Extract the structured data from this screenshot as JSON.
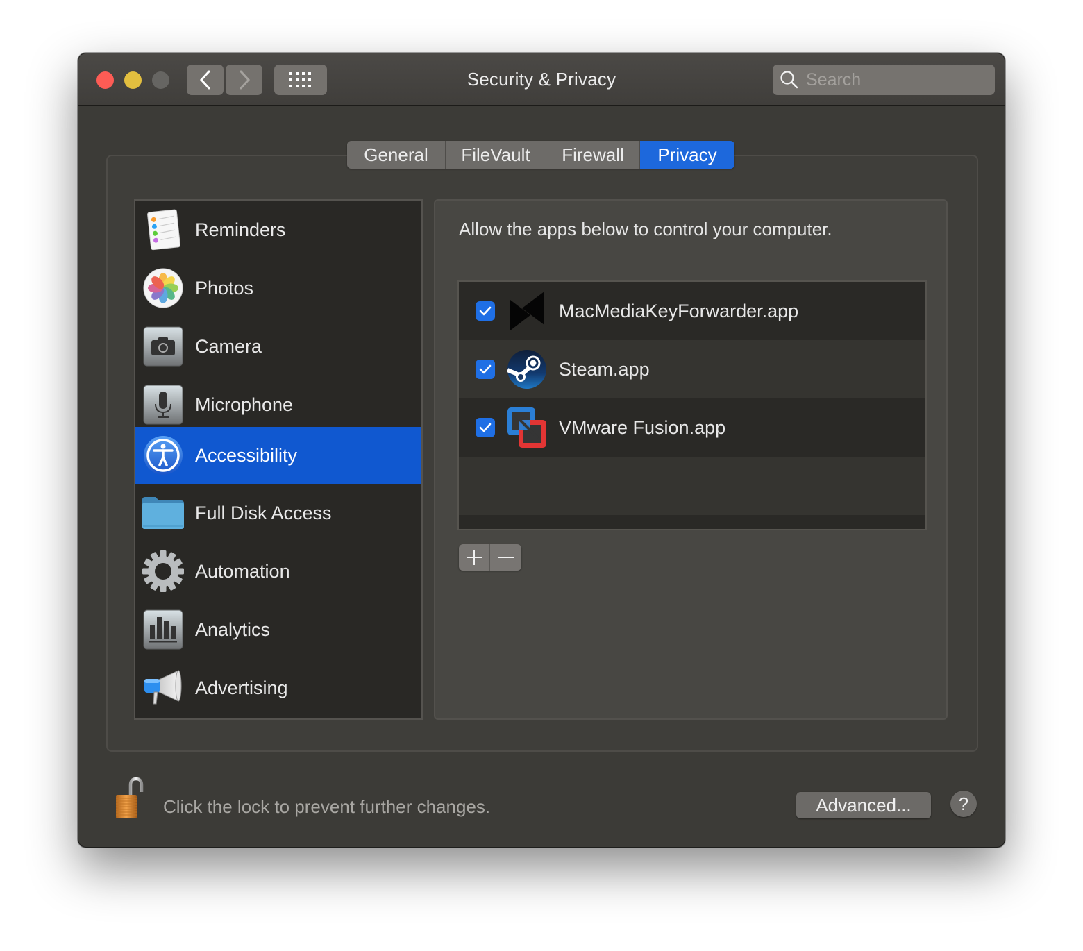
{
  "window": {
    "title": "Security & Privacy",
    "traffic_lights": {
      "close": "#fd5c55",
      "minimize": "#e3bf3f",
      "zoom": "#666562"
    },
    "nav": {
      "back_icon": "chevron-left-icon",
      "forward_icon": "chevron-right-icon",
      "grid_icon": "grid-icon"
    },
    "search": {
      "placeholder": "Search",
      "value": "",
      "icon": "search-icon"
    }
  },
  "tabs": [
    {
      "label": "General",
      "active": false
    },
    {
      "label": "FileVault",
      "active": false
    },
    {
      "label": "Firewall",
      "active": false
    },
    {
      "label": "Privacy",
      "active": true
    }
  ],
  "accent_color": "#1d68dc",
  "sidebar": {
    "items": [
      {
        "label": "Reminders",
        "icon": "reminders-icon",
        "selected": false
      },
      {
        "label": "Photos",
        "icon": "photos-icon",
        "selected": false
      },
      {
        "label": "Camera",
        "icon": "camera-icon",
        "selected": false
      },
      {
        "label": "Microphone",
        "icon": "microphone-icon",
        "selected": false
      },
      {
        "label": "Accessibility",
        "icon": "accessibility-icon",
        "selected": true
      },
      {
        "label": "Full Disk Access",
        "icon": "folder-icon",
        "selected": false
      },
      {
        "label": "Automation",
        "icon": "gear-icon",
        "selected": false
      },
      {
        "label": "Analytics",
        "icon": "bar-chart-icon",
        "selected": false
      },
      {
        "label": "Advertising",
        "icon": "megaphone-icon",
        "selected": false
      }
    ]
  },
  "panel": {
    "heading": "Allow the apps below to control your computer.",
    "apps": [
      {
        "name": "MacMediaKeyForwarder.app",
        "checked": true,
        "icon": "media-key-forwarder-icon"
      },
      {
        "name": "Steam.app",
        "checked": true,
        "icon": "steam-icon"
      },
      {
        "name": "VMware Fusion.app",
        "checked": true,
        "icon": "vmware-fusion-icon"
      }
    ],
    "add_label": "+",
    "remove_label": "−"
  },
  "footer": {
    "lock_text": "Click the lock to prevent further changes.",
    "lock_state": "unlocked",
    "advanced_label": "Advanced...",
    "help_label": "?"
  }
}
